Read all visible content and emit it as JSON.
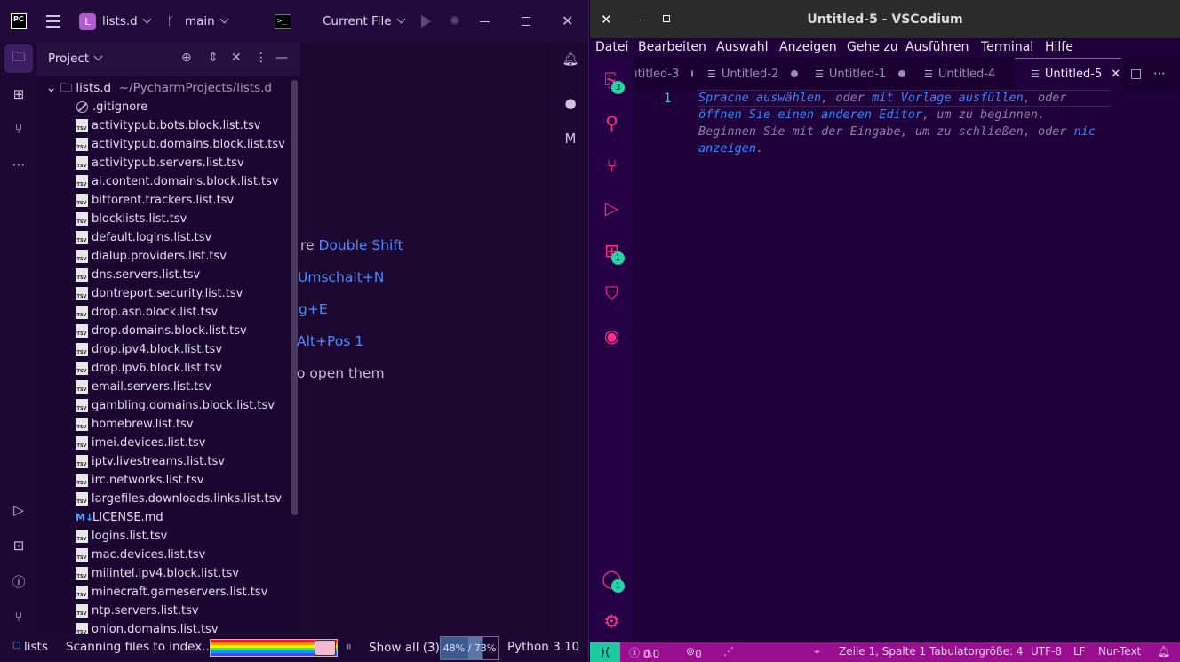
{
  "pycharm": {
    "logo_text": "PC",
    "project_badge": "L",
    "project_name": "lists.d",
    "branch": "main",
    "run_config": "Current File",
    "project_panel": {
      "title": "Project",
      "root_name": "lists.d",
      "root_path": "~/PycharmProjects/lists.d",
      "files": [
        {
          "name": ".gitignore",
          "icon": "gitignore-icon"
        },
        {
          "name": "activitypub.bots.block.list.tsv",
          "icon": "tsv-file-icon"
        },
        {
          "name": "activitypub.domains.block.list.tsv",
          "icon": "tsv-file-icon"
        },
        {
          "name": "activitypub.servers.list.tsv",
          "icon": "tsv-file-icon"
        },
        {
          "name": "ai.content.domains.block.list.tsv",
          "icon": "tsv-file-icon"
        },
        {
          "name": "bittorent.trackers.list.tsv",
          "icon": "tsv-file-icon"
        },
        {
          "name": "blocklists.list.tsv",
          "icon": "tsv-file-icon"
        },
        {
          "name": "default.logins.list.tsv",
          "icon": "tsv-file-icon"
        },
        {
          "name": "dialup.providers.list.tsv",
          "icon": "tsv-file-icon"
        },
        {
          "name": "dns.servers.list.tsv",
          "icon": "tsv-file-icon"
        },
        {
          "name": "dontreport.security.list.tsv",
          "icon": "tsv-file-icon"
        },
        {
          "name": "drop.asn.block.list.tsv",
          "icon": "tsv-file-icon"
        },
        {
          "name": "drop.domains.block.list.tsv",
          "icon": "tsv-file-icon"
        },
        {
          "name": "drop.ipv4.block.list.tsv",
          "icon": "tsv-file-icon"
        },
        {
          "name": "drop.ipv6.block.list.tsv",
          "icon": "tsv-file-icon"
        },
        {
          "name": "email.servers.list.tsv",
          "icon": "tsv-file-icon"
        },
        {
          "name": "gambling.domains.block.list.tsv",
          "icon": "tsv-file-icon"
        },
        {
          "name": "homebrew.list.tsv",
          "icon": "tsv-file-icon"
        },
        {
          "name": "imei.devices.list.tsv",
          "icon": "tsv-file-icon"
        },
        {
          "name": "iptv.livestreams.list.tsv",
          "icon": "tsv-file-icon"
        },
        {
          "name": "irc.networks.list.tsv",
          "icon": "tsv-file-icon"
        },
        {
          "name": "largefiles.downloads.links.list.tsv",
          "icon": "tsv-file-icon"
        },
        {
          "name": "LICENSE.md",
          "icon": "markdown-icon"
        },
        {
          "name": "logins.list.tsv",
          "icon": "tsv-file-icon"
        },
        {
          "name": "mac.devices.list.tsv",
          "icon": "tsv-file-icon"
        },
        {
          "name": "milintel.ipv4.block.list.tsv",
          "icon": "tsv-file-icon"
        },
        {
          "name": "minecraft.gameservers.list.tsv",
          "icon": "tsv-file-icon"
        },
        {
          "name": "ntp.servers.list.tsv",
          "icon": "tsv-file-icon"
        },
        {
          "name": "onion.domains.list.tsv",
          "icon": "tsv-file-icon"
        }
      ],
      "tsv_icon_text": "TSV",
      "md_icon_text": "M↓"
    },
    "editor_hints": [
      {
        "text": "re ",
        "shortcut": "Double Shift"
      },
      {
        "text": "",
        "shortcut": "Umschalt+N"
      },
      {
        "text": "",
        "shortcut": "g+E"
      },
      {
        "text": "",
        "shortcut": "Alt+Pos 1"
      },
      {
        "text": "o open them",
        "shortcut": ""
      }
    ],
    "status": {
      "breadcrumb": "lists",
      "indexing": "Scanning files to index...",
      "show_all": "Show all (3)",
      "memory": "48% / 73%",
      "memory_used": 48,
      "memory_committed": 73,
      "interpreter": "Python 3.10"
    }
  },
  "vscodium": {
    "window_title": "Untitled-5 - VSCodium",
    "menu": [
      "Datei",
      "Bearbeiten",
      "Auswahl",
      "Anzeigen",
      "Gehe zu",
      "Ausführen",
      "Terminal",
      "Hilfe"
    ],
    "tabs": [
      {
        "label": "ıtitled-3",
        "dirty": true,
        "active": false
      },
      {
        "label": "Untitled-2",
        "dirty": true,
        "active": false
      },
      {
        "label": "Untitled-1",
        "dirty": true,
        "active": false
      },
      {
        "label": "Untitled-4",
        "dirty": false,
        "active": false
      },
      {
        "label": "Untitled-5",
        "dirty": false,
        "active": true
      }
    ],
    "activity_badges": {
      "explorer": "3",
      "extensions": "1",
      "accounts": "1"
    },
    "editor": {
      "line_number": "1",
      "lines": [
        [
          {
            "t": "Sprache auswählen",
            "link": true
          },
          {
            "t": ", oder ",
            "link": false
          },
          {
            "t": "mit Vorlage ausfüllen",
            "link": true
          },
          {
            "t": ", oder",
            "link": false
          }
        ],
        [
          {
            "t": "öffnen Sie einen anderen Editor",
            "link": true
          },
          {
            "t": ", um zu beginnen.",
            "link": false
          }
        ],
        [
          {
            "t": "Beginnen Sie mit der Eingabe, um zu schließen, oder ",
            "link": false
          },
          {
            "t": "nic",
            "link": true
          }
        ],
        [
          {
            "t": "anzeigen",
            "link": true
          },
          {
            "t": ".",
            "link": false
          }
        ]
      ]
    },
    "status": {
      "errors": "0",
      "warnings": "0",
      "ports": "0",
      "position": "Zeile 1, Spalte 1",
      "tab_size": "Tabulatorgröße: 4",
      "encoding": "UTF-8",
      "eol": "LF",
      "language": "Nur-Text"
    }
  }
}
